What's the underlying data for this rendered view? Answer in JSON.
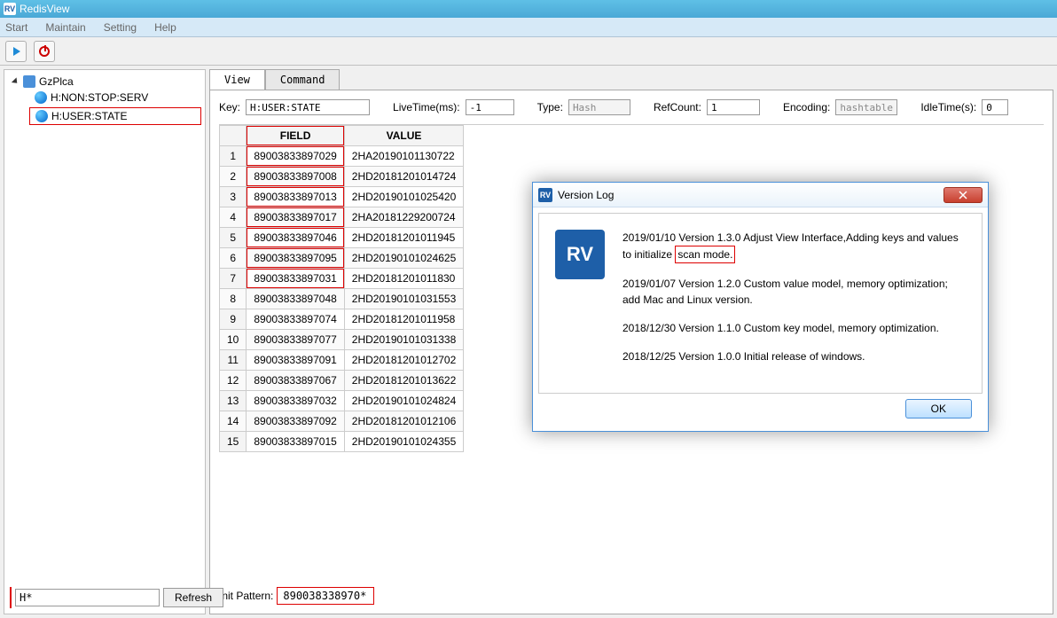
{
  "window": {
    "title": "RedisView"
  },
  "menu": {
    "items": [
      "Start",
      "Maintain",
      "Setting",
      "Help"
    ]
  },
  "sidebar": {
    "root": "GzPlca",
    "children": [
      "H:NON:STOP:SERV",
      "H:USER:STATE"
    ],
    "filter_value": "H*",
    "refresh_label": "Refresh"
  },
  "tabs": {
    "view": "View",
    "command": "Command"
  },
  "info": {
    "key_label": "Key:",
    "key_value": "H:USER:STATE",
    "live_label": "LiveTime(ms):",
    "live_value": "-1",
    "type_label": "Type:",
    "type_value": "Hash",
    "ref_label": "RefCount:",
    "ref_value": "1",
    "enc_label": "Encoding:",
    "enc_value": "hashtable",
    "idle_label": "IdleTime(s):",
    "idle_value": "0"
  },
  "table": {
    "headers": {
      "field": "FIELD",
      "value": "VALUE"
    },
    "rows": [
      {
        "n": "1",
        "f": "89003833897029",
        "v": "2HA20190101130722"
      },
      {
        "n": "2",
        "f": "89003833897008",
        "v": "2HD20181201014724"
      },
      {
        "n": "3",
        "f": "89003833897013",
        "v": "2HD20190101025420"
      },
      {
        "n": "4",
        "f": "89003833897017",
        "v": "2HA20181229200724"
      },
      {
        "n": "5",
        "f": "89003833897046",
        "v": "2HD20181201011945"
      },
      {
        "n": "6",
        "f": "89003833897095",
        "v": "2HD20190101024625"
      },
      {
        "n": "7",
        "f": "89003833897031",
        "v": "2HD20181201011830"
      },
      {
        "n": "8",
        "f": "89003833897048",
        "v": "2HD20190101031553"
      },
      {
        "n": "9",
        "f": "89003833897074",
        "v": "2HD20181201011958"
      },
      {
        "n": "10",
        "f": "89003833897077",
        "v": "2HD20190101031338"
      },
      {
        "n": "11",
        "f": "89003833897091",
        "v": "2HD20181201012702"
      },
      {
        "n": "12",
        "f": "89003833897067",
        "v": "2HD20181201013622"
      },
      {
        "n": "13",
        "f": "89003833897032",
        "v": "2HD20190101024824"
      },
      {
        "n": "14",
        "f": "89003833897092",
        "v": "2HD20181201012106"
      },
      {
        "n": "15",
        "f": "89003833897015",
        "v": "2HD20190101024355"
      }
    ]
  },
  "init_pattern": {
    "label": "Init Pattern:",
    "value": "890038338970*"
  },
  "dialog": {
    "title": "Version Log",
    "entries": [
      {
        "pre": "2019/01/10  Version 1.3.0  Adjust View Interface,Adding keys and values to initialize ",
        "hl": "scan mode.",
        "post": ""
      },
      {
        "pre": "2019/01/07  Version 1.2.0  Custom value model, memory optimization; add Mac and Linux version.",
        "hl": "",
        "post": ""
      },
      {
        "pre": "2018/12/30  Version 1.1.0  Custom key model, memory optimization.",
        "hl": "",
        "post": ""
      },
      {
        "pre": "2018/12/25  Version 1.0.0  Initial release of windows.",
        "hl": "",
        "post": ""
      }
    ],
    "ok": "OK"
  }
}
